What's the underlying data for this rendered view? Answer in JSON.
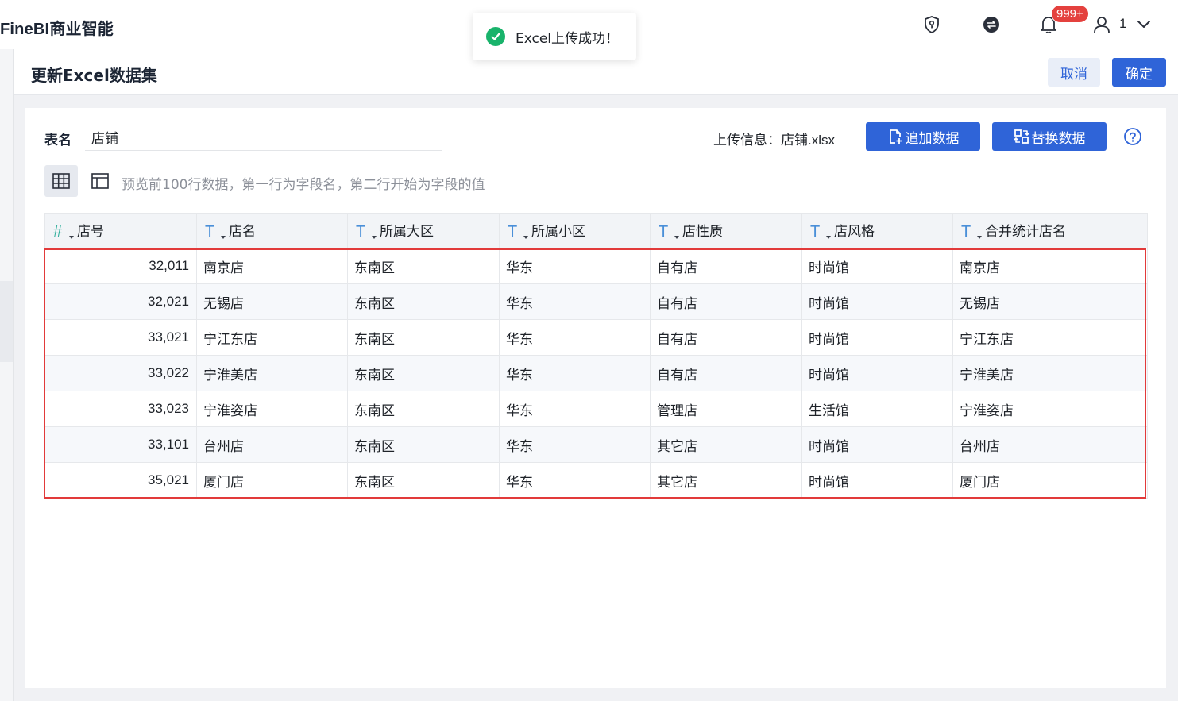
{
  "app": {
    "title": "FineBI商业智能",
    "notification_count": "999+",
    "user_name": "1"
  },
  "toast": {
    "message": "Excel上传成功！",
    "icon": "check-circle-icon",
    "color": "#19b36b"
  },
  "page": {
    "title": "更新Excel数据集",
    "cancel_label": "取消",
    "confirm_label": "确定"
  },
  "form": {
    "name_label": "表名",
    "name_value": "店铺",
    "upload_info_label": "上传信息：",
    "upload_file": "店铺.xlsx",
    "append_label": "追加数据",
    "replace_label": "替换数据",
    "hint": "预览前100行数据，第一行为字段名，第二行开始为字段的值"
  },
  "colors": {
    "accent": "#2f64d8",
    "highlight_border": "#e23a3a",
    "badge": "#e4413e"
  },
  "table": {
    "columns": [
      {
        "type": "#",
        "name": "店号"
      },
      {
        "type": "T",
        "name": "店名"
      },
      {
        "type": "T",
        "name": "所属大区"
      },
      {
        "type": "T",
        "name": "所属小区"
      },
      {
        "type": "T",
        "name": "店性质"
      },
      {
        "type": "T",
        "name": "店风格"
      },
      {
        "type": "T",
        "name": "合并统计店名"
      }
    ],
    "rows": [
      [
        "32,011",
        "南京店",
        "东南区",
        "华东",
        "自有店",
        "时尚馆",
        "南京店"
      ],
      [
        "32,021",
        "无锡店",
        "东南区",
        "华东",
        "自有店",
        "时尚馆",
        "无锡店"
      ],
      [
        "33,021",
        "宁江东店",
        "东南区",
        "华东",
        "自有店",
        "时尚馆",
        "宁江东店"
      ],
      [
        "33,022",
        "宁淮美店",
        "东南区",
        "华东",
        "自有店",
        "时尚馆",
        "宁淮美店"
      ],
      [
        "33,023",
        "宁淮姿店",
        "东南区",
        "华东",
        "管理店",
        "生活馆",
        "宁淮姿店"
      ],
      [
        "33,101",
        "台州店",
        "东南区",
        "华东",
        "其它店",
        "时尚馆",
        "台州店"
      ],
      [
        "35,021",
        "厦门店",
        "东南区",
        "华东",
        "其它店",
        "时尚馆",
        "厦门店"
      ]
    ]
  }
}
